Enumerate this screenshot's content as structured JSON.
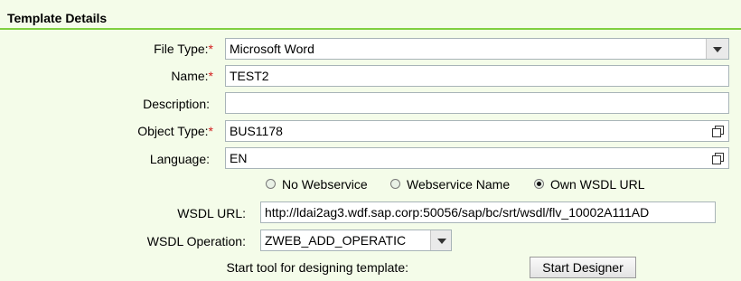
{
  "section": {
    "title": "Template Details"
  },
  "form": {
    "file_type": {
      "label": "File Type:",
      "required": "*",
      "value": "Microsoft Word"
    },
    "name": {
      "label": "Name:",
      "required": "*",
      "value": "TEST2"
    },
    "description": {
      "label": "Description:",
      "value": ""
    },
    "object_type": {
      "label": "Object Type:",
      "required": "*",
      "value": "BUS1178"
    },
    "language": {
      "label": "Language:",
      "value": "EN"
    },
    "webservice_options": [
      {
        "label": "No Webservice",
        "selected": false
      },
      {
        "label": "Webservice Name",
        "selected": false
      },
      {
        "label": "Own WSDL URL",
        "selected": true
      }
    ],
    "wsdl_url": {
      "label": "WSDL URL:",
      "value": "http://ldai2ag3.wdf.sap.corp:50056/sap/bc/srt/wsdl/flv_10002A111AD"
    },
    "wsdl_operation": {
      "label": "WSDL Operation:",
      "value": "ZWEB_ADD_OPERATIC"
    },
    "designer": {
      "label": "Start tool for designing template:",
      "button": "Start Designer"
    }
  },
  "colors": {
    "background": "#f4fce9",
    "accent_line": "#7fcf3f",
    "required": "#d21c1c"
  }
}
